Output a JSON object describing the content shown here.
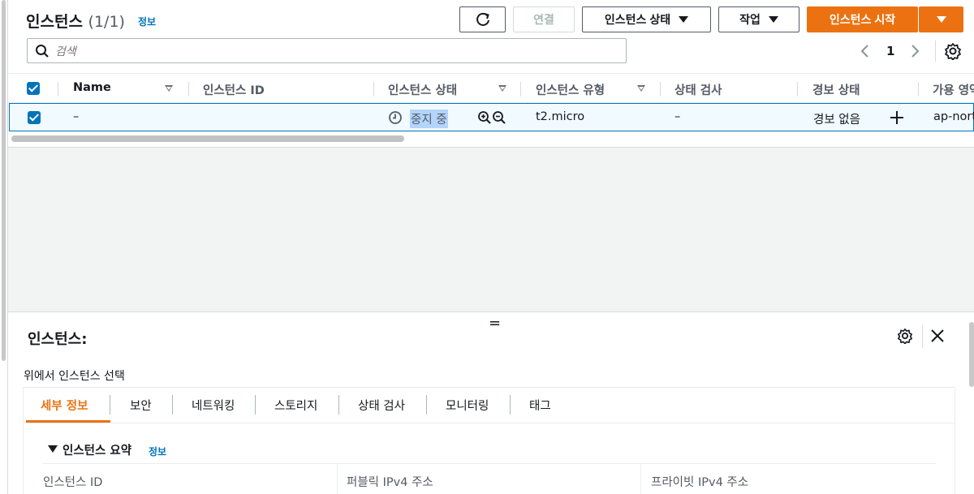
{
  "header": {
    "title": "인스턴스",
    "count": "(1/1)",
    "info": "정보"
  },
  "toolbar": {
    "connect": "연결",
    "instance_state": "인스턴스 상태",
    "actions": "작업",
    "start_instance": "인스턴스 시작"
  },
  "search": {
    "placeholder": "검색"
  },
  "pagination": {
    "current_page": "1"
  },
  "table": {
    "columns": [
      "Name",
      "인스턴스 ID",
      "인스턴스 상태",
      "인스턴스 유형",
      "상태 검사",
      "경보 상태",
      "가용 영역"
    ],
    "rows": [
      {
        "name": "–",
        "instance_id": "",
        "state": "중지 중",
        "type": "t2.micro",
        "status_check": "–",
        "alarm_status": "경보 없음",
        "availability_zone": "ap-nort"
      }
    ]
  },
  "detail": {
    "resize_glyph": "=",
    "title": "인스턴스:",
    "subtitle": "위에서 인스턴스 선택",
    "tabs": [
      "세부 정보",
      "보안",
      "네트워킹",
      "스토리지",
      "상태 검사",
      "모니터링",
      "태그"
    ],
    "section_title": "인스턴스 요약",
    "section_info": "정보",
    "fields": [
      "인스턴스 ID",
      "퍼블릭 IPv4 주소",
      "프라이빗 IPv4 주소"
    ]
  },
  "colors": {
    "accent_orange": "#ec7211",
    "link_blue": "#0073bb",
    "selected_row_bg": "#f1faff"
  },
  "icons": [
    "refresh-icon",
    "caret-down-icon",
    "search-icon",
    "chevron-left-icon",
    "chevron-right-icon",
    "settings-icon",
    "clock-icon",
    "zoom-in-icon",
    "zoom-out-icon",
    "plus-icon",
    "close-icon",
    "triangle-down-icon"
  ]
}
